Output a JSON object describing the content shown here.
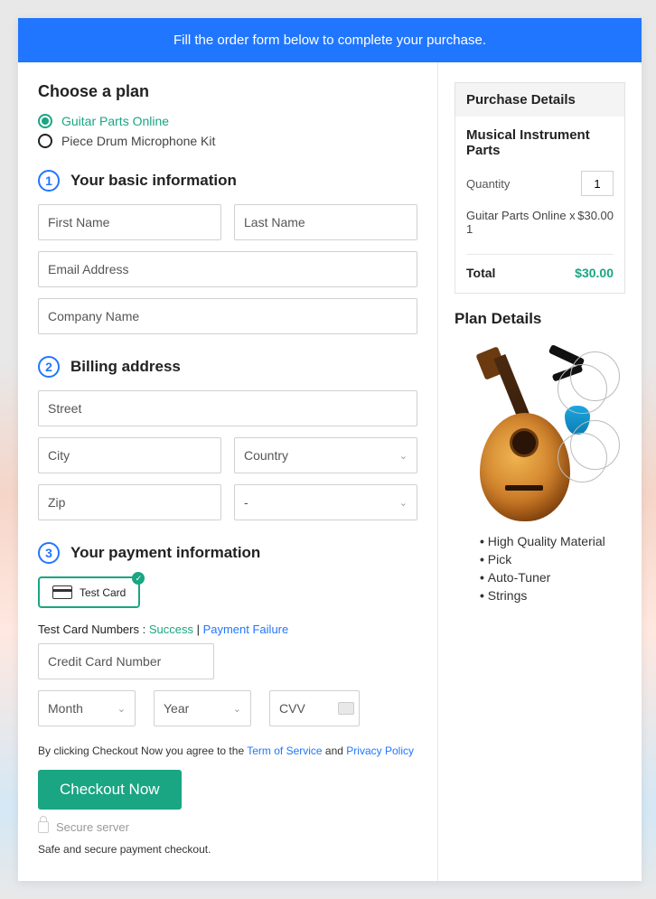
{
  "banner": "Fill the order form below to complete your purchase.",
  "plan": {
    "title": "Choose a plan",
    "options": [
      "Guitar Parts Online",
      "Piece Drum Microphone Kit"
    ],
    "selected": 0
  },
  "steps": {
    "s1": {
      "num": "1",
      "title": "Your basic information"
    },
    "s2": {
      "num": "2",
      "title": "Billing address"
    },
    "s3": {
      "num": "3",
      "title": "Your payment information"
    }
  },
  "basic": {
    "first_name": "First Name",
    "last_name": "Last Name",
    "email": "Email Address",
    "company": "Company Name"
  },
  "billing": {
    "street": "Street",
    "city": "City",
    "country": "Country",
    "zip": "Zip",
    "state": "-"
  },
  "payment": {
    "card_label": "Test  Card",
    "test_prefix": "Test Card Numbers : ",
    "success": "Success",
    "separator": " | ",
    "failure": "Payment Failure",
    "cc_number": "Credit Card Number",
    "month": "Month",
    "year": "Year",
    "cvv": "CVV"
  },
  "terms": {
    "prefix": "By clicking Checkout Now you agree to the ",
    "tos": "Term of Service",
    "and": " and ",
    "privacy": "Privacy Policy"
  },
  "checkout_label": "Checkout Now",
  "secure": "Secure server",
  "safe_note": "Safe and secure payment checkout.",
  "purchase": {
    "panel_title": "Purchase Details",
    "product": "Musical Instrument Parts",
    "qty_label": "Quantity",
    "qty_value": "1",
    "line_label": "Guitar Parts Online x 1",
    "line_price": "$30.00",
    "total_label": "Total",
    "total_price": "$30.00"
  },
  "plan_details": {
    "title": "Plan Details",
    "features": [
      "High Quality Material",
      "Pick",
      "Auto-Tuner",
      "Strings"
    ]
  }
}
